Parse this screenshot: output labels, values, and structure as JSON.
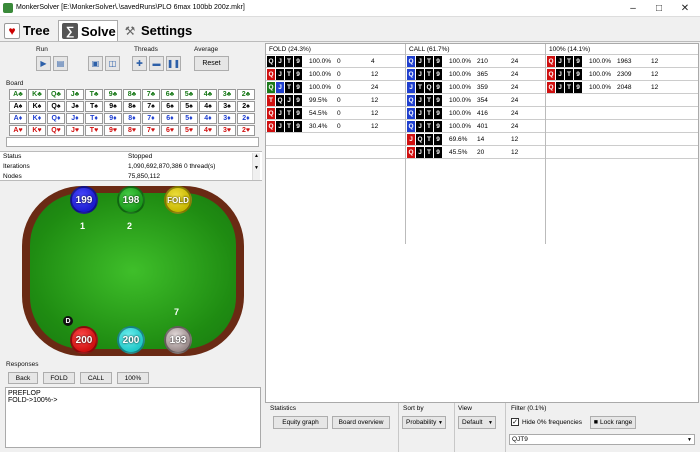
{
  "window": {
    "title": "MonkerSolver [E:\\MonkerSolver\\.\\savedRuns\\PLO 6max 100bb 200z.mkr]"
  },
  "tabs": [
    {
      "label": "Tree"
    },
    {
      "label": "Solve"
    },
    {
      "label": "Settings"
    }
  ],
  "controls": {
    "run_label": "Run",
    "threads_label": "Threads",
    "average_label": "Average",
    "reset_label": "Reset",
    "board_label": "Board"
  },
  "board": {
    "ranks": [
      "A",
      "K",
      "Q",
      "J",
      "T",
      "9",
      "8",
      "7",
      "6",
      "5",
      "4",
      "3",
      "2"
    ],
    "suits": [
      {
        "symbol": "♣",
        "color": "#1a7a1a"
      },
      {
        "symbol": "♠",
        "color": "#000000"
      },
      {
        "symbol": "♦",
        "color": "#1f3fcf"
      },
      {
        "symbol": "♥",
        "color": "#d01010"
      }
    ]
  },
  "status": {
    "rows": [
      {
        "key": "Status",
        "value": "Stopped"
      },
      {
        "key": "Iterations",
        "value": "1,090,692,870,386  0 thread(s)"
      },
      {
        "key": "Nodes",
        "value": "75,850,112"
      }
    ]
  },
  "seats": [
    {
      "stack": "199",
      "color": "#1a1ad0",
      "number": "1"
    },
    {
      "stack": "198",
      "color": "#1a9a1a",
      "number": "2"
    },
    {
      "stack": "FOLD",
      "color": "#c8b800",
      "number": ""
    },
    {
      "stack": "193",
      "color": "#b8b0b0",
      "number": "7"
    },
    {
      "stack": "200",
      "color": "#20c8c8",
      "number": ""
    },
    {
      "stack": "200",
      "color": "#d01010",
      "number": "D"
    }
  ],
  "responses": {
    "label": "Responses",
    "buttons": [
      "Back",
      "FOLD",
      "CALL",
      "100%"
    ],
    "log": [
      "PREFLOP",
      "FOLD->100%->"
    ]
  },
  "grid": {
    "columns": [
      {
        "header": "FOLD (24.3%)",
        "rows": [
          {
            "cards": [
              {
                "r": "Q",
                "c": "#000"
              },
              {
                "r": "J",
                "c": "#000"
              },
              {
                "r": "T",
                "c": "#000"
              },
              {
                "r": "9",
                "c": "#000"
              }
            ],
            "pct": "100.0%",
            "a": "0",
            "b": "4"
          },
          {
            "cards": [
              {
                "r": "Q",
                "c": "#d01010"
              },
              {
                "r": "J",
                "c": "#000"
              },
              {
                "r": "T",
                "c": "#000"
              },
              {
                "r": "9",
                "c": "#000"
              }
            ],
            "pct": "100.0%",
            "a": "0",
            "b": "12"
          },
          {
            "cards": [
              {
                "r": "Q",
                "c": "#1a7a1a"
              },
              {
                "r": "J",
                "c": "#1f3fcf"
              },
              {
                "r": "T",
                "c": "#000"
              },
              {
                "r": "9",
                "c": "#000"
              }
            ],
            "pct": "100.0%",
            "a": "0",
            "b": "24"
          },
          {
            "cards": [
              {
                "r": "T",
                "c": "#d01010"
              },
              {
                "r": "Q",
                "c": "#000"
              },
              {
                "r": "J",
                "c": "#000"
              },
              {
                "r": "9",
                "c": "#000"
              }
            ],
            "pct": "99.5%",
            "a": "0",
            "b": "12"
          },
          {
            "cards": [
              {
                "r": "Q",
                "c": "#d01010"
              },
              {
                "r": "J",
                "c": "#000"
              },
              {
                "r": "T",
                "c": "#000"
              },
              {
                "r": "9",
                "c": "#000"
              }
            ],
            "pct": "54.5%",
            "a": "0",
            "b": "12"
          },
          {
            "cards": [
              {
                "r": "Q",
                "c": "#d01010"
              },
              {
                "r": "J",
                "c": "#000"
              },
              {
                "r": "T",
                "c": "#000"
              },
              {
                "r": "9",
                "c": "#000"
              }
            ],
            "pct": "30.4%",
            "a": "0",
            "b": "12"
          }
        ]
      },
      {
        "header": "CALL (61.7%)",
        "rows": [
          {
            "cards": [
              {
                "r": "Q",
                "c": "#1f3fcf"
              },
              {
                "r": "J",
                "c": "#000"
              },
              {
                "r": "T",
                "c": "#000"
              },
              {
                "r": "9",
                "c": "#000"
              }
            ],
            "pct": "100.0%",
            "a": "210",
            "b": "24"
          },
          {
            "cards": [
              {
                "r": "Q",
                "c": "#1f3fcf"
              },
              {
                "r": "J",
                "c": "#000"
              },
              {
                "r": "T",
                "c": "#000"
              },
              {
                "r": "9",
                "c": "#000"
              }
            ],
            "pct": "100.0%",
            "a": "365",
            "b": "24"
          },
          {
            "cards": [
              {
                "r": "J",
                "c": "#1f3fcf"
              },
              {
                "r": "T",
                "c": "#000"
              },
              {
                "r": "Q",
                "c": "#000"
              },
              {
                "r": "9",
                "c": "#000"
              }
            ],
            "pct": "100.0%",
            "a": "359",
            "b": "24"
          },
          {
            "cards": [
              {
                "r": "Q",
                "c": "#1f3fcf"
              },
              {
                "r": "J",
                "c": "#000"
              },
              {
                "r": "T",
                "c": "#000"
              },
              {
                "r": "9",
                "c": "#000"
              }
            ],
            "pct": "100.0%",
            "a": "354",
            "b": "24"
          },
          {
            "cards": [
              {
                "r": "Q",
                "c": "#1f3fcf"
              },
              {
                "r": "J",
                "c": "#000"
              },
              {
                "r": "T",
                "c": "#000"
              },
              {
                "r": "9",
                "c": "#000"
              }
            ],
            "pct": "100.0%",
            "a": "416",
            "b": "24"
          },
          {
            "cards": [
              {
                "r": "Q",
                "c": "#1f3fcf"
              },
              {
                "r": "J",
                "c": "#000"
              },
              {
                "r": "T",
                "c": "#000"
              },
              {
                "r": "9",
                "c": "#000"
              }
            ],
            "pct": "100.0%",
            "a": "401",
            "b": "24"
          },
          {
            "cards": [
              {
                "r": "J",
                "c": "#d01010"
              },
              {
                "r": "Q",
                "c": "#000"
              },
              {
                "r": "T",
                "c": "#000"
              },
              {
                "r": "9",
                "c": "#000"
              }
            ],
            "pct": "69.6%",
            "a": "14",
            "b": "12"
          },
          {
            "cards": [
              {
                "r": "Q",
                "c": "#d01010"
              },
              {
                "r": "J",
                "c": "#000"
              },
              {
                "r": "T",
                "c": "#000"
              },
              {
                "r": "9",
                "c": "#000"
              }
            ],
            "pct": "45.5%",
            "a": "20",
            "b": "12"
          }
        ]
      },
      {
        "header": "100% (14.1%)",
        "rows": [
          {
            "cards": [
              {
                "r": "Q",
                "c": "#d01010"
              },
              {
                "r": "J",
                "c": "#000"
              },
              {
                "r": "T",
                "c": "#000"
              },
              {
                "r": "9",
                "c": "#000"
              }
            ],
            "pct": "100.0%",
            "a": "1963",
            "b": "12"
          },
          {
            "cards": [
              {
                "r": "Q",
                "c": "#d01010"
              },
              {
                "r": "J",
                "c": "#000"
              },
              {
                "r": "T",
                "c": "#000"
              },
              {
                "r": "9",
                "c": "#000"
              }
            ],
            "pct": "100.0%",
            "a": "2309",
            "b": "12"
          },
          {
            "cards": [
              {
                "r": "Q",
                "c": "#d01010"
              },
              {
                "r": "J",
                "c": "#000"
              },
              {
                "r": "T",
                "c": "#000"
              },
              {
                "r": "9",
                "c": "#000"
              }
            ],
            "pct": "100.0%",
            "a": "2048",
            "b": "12"
          }
        ]
      }
    ]
  },
  "bottom": {
    "statistics_label": "Statistics",
    "equity_button": "Equity graph",
    "board_overview_button": "Board overview",
    "sortby_label": "Sort by",
    "sortby_value": "Probability",
    "view_label": "View",
    "view_value": "Default",
    "filter_label": "Filter (0.1%)",
    "hide_label": "Hide 0% frequencies",
    "lock_label": "Lock range",
    "filter_value": "QJT9"
  }
}
